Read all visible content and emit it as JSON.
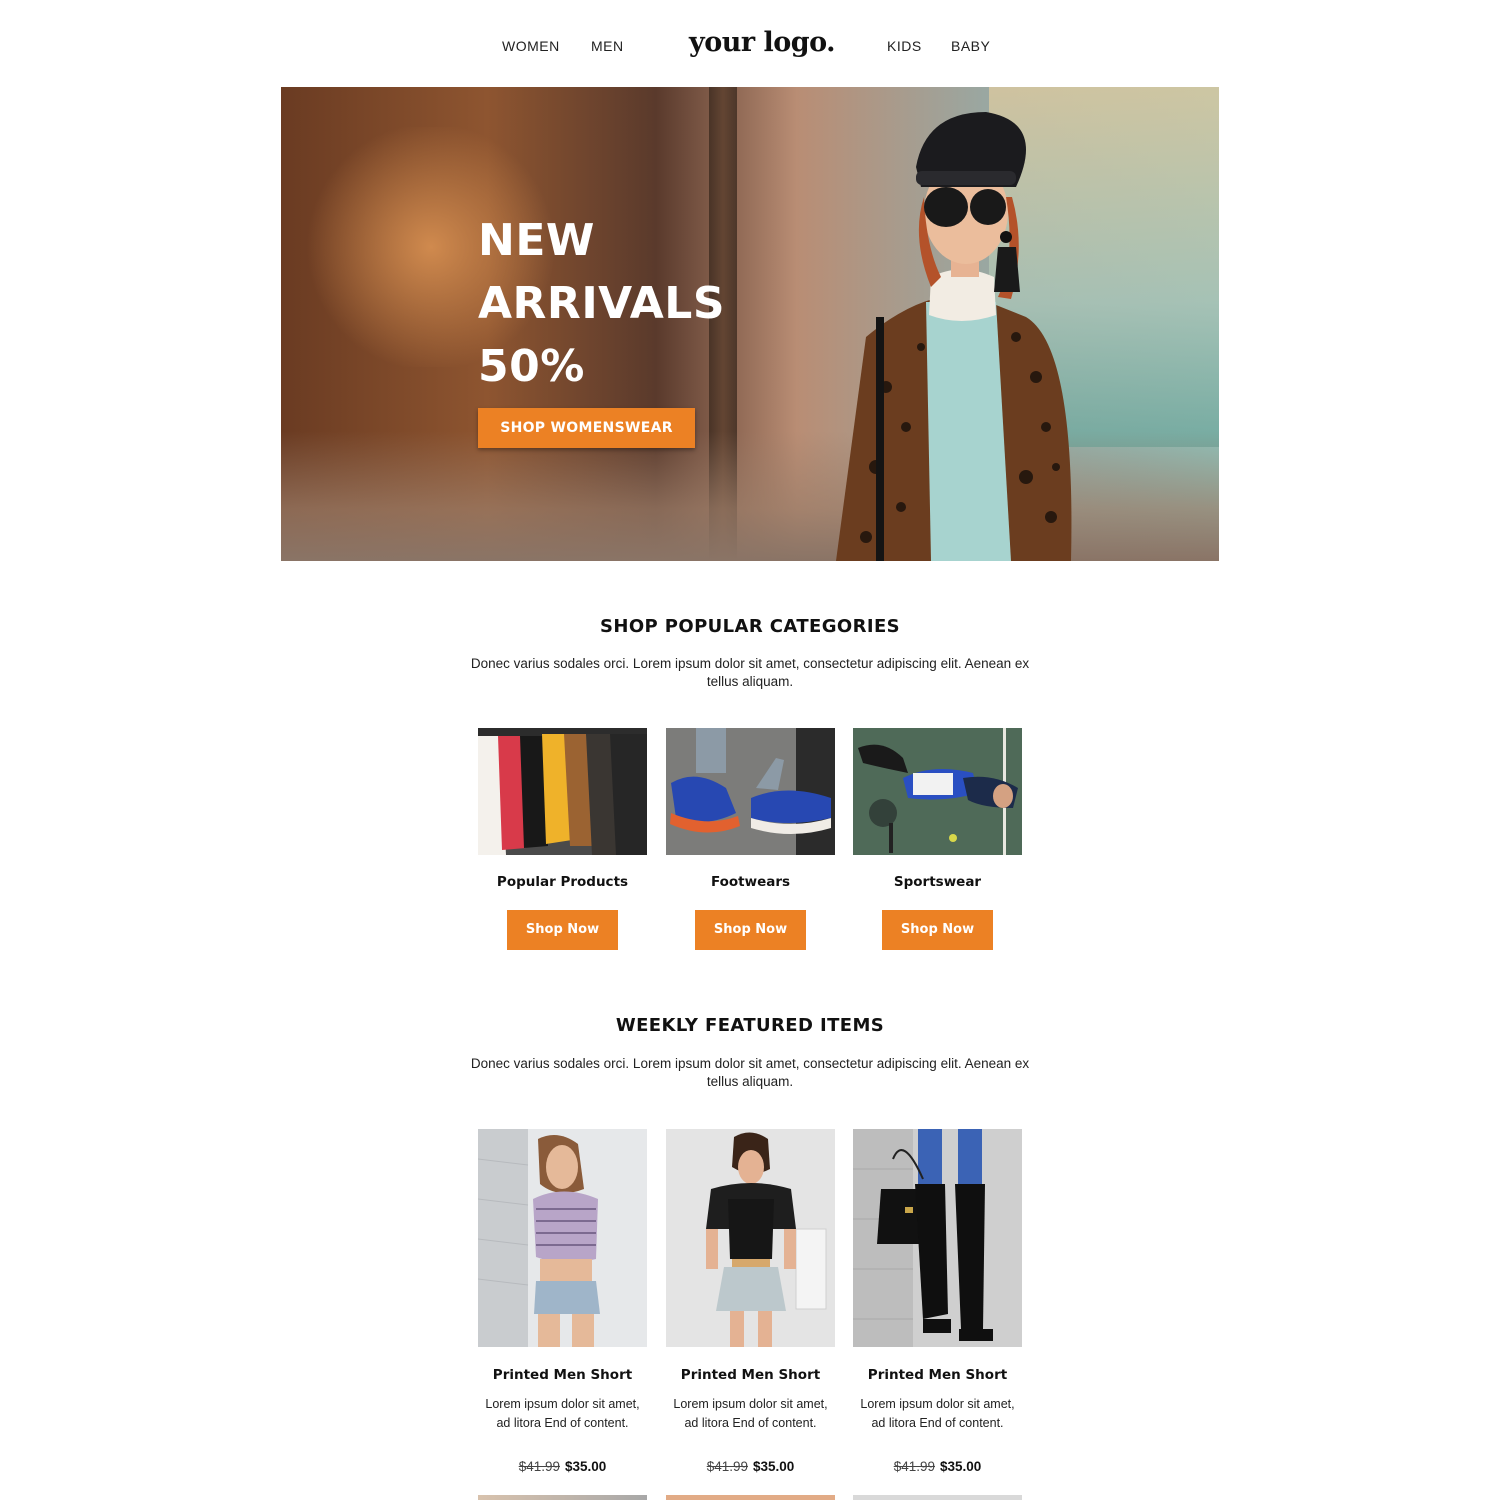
{
  "nav": {
    "left": [
      "WOMEN",
      "MEN"
    ],
    "logo": "your logo.",
    "right": [
      "KIDS",
      "BABY"
    ]
  },
  "hero": {
    "title": "NEW\nARRIVALS\n50%",
    "button": "SHOP WOMENSWEAR"
  },
  "categories": {
    "title": "SHOP POPULAR CATEGORIES",
    "description": "Donec varius sodales orci. Lorem ipsum dolor sit amet, consectetur adipiscing elit. Aenean ex tellus aliquam.",
    "items": [
      {
        "name": "Popular Products",
        "button": "Shop Now"
      },
      {
        "name": "Footwears",
        "button": "Shop Now"
      },
      {
        "name": "Sportswear",
        "button": "Shop Now"
      }
    ]
  },
  "featured": {
    "title": "WEEKLY FEATURED ITEMS",
    "description": "Donec varius sodales orci. Lorem ipsum dolor sit amet, consectetur adipiscing elit. Aenean ex tellus aliquam.",
    "items": [
      {
        "name": "Printed Men Short",
        "description": "Lorem ipsum dolor sit amet, ad litora End of content.",
        "old_price": "$41.99",
        "price": "$35.00"
      },
      {
        "name": "Printed Men Short",
        "description": "Lorem ipsum dolor sit amet, ad litora End of content.",
        "old_price": "$41.99",
        "price": "$35.00"
      },
      {
        "name": "Printed Men Short",
        "description": "Lorem ipsum dolor sit amet, ad litora End of content.",
        "old_price": "$41.99",
        "price": "$35.00"
      }
    ]
  },
  "colors": {
    "accent": "#ec8124",
    "text": "#111111",
    "background": "#ffffff"
  }
}
